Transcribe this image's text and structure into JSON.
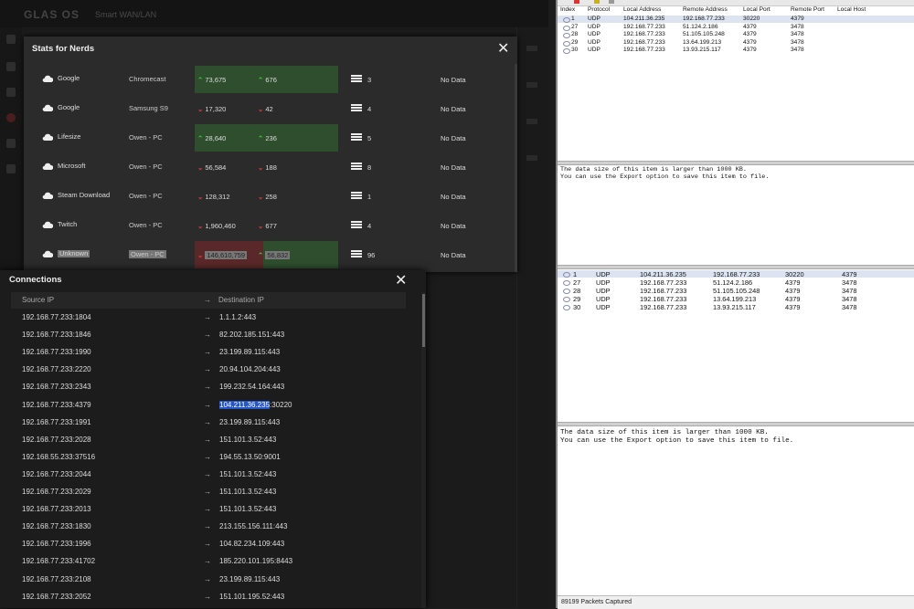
{
  "background_app": {
    "logo": "GLAS OS",
    "device_name": "Smart WAN/LAN"
  },
  "stats_for_nerds": {
    "title": "Stats for Nerds",
    "rows": [
      {
        "app": "Google",
        "device": "Chromecast",
        "down": "73,675",
        "up": "676",
        "count": "3",
        "status": "No Data",
        "tone": "green"
      },
      {
        "app": "Google",
        "device": "Samsung S9",
        "down": "17,320",
        "up": "42",
        "count": "4",
        "status": "No Data",
        "tone": "none"
      },
      {
        "app": "Lifesize",
        "device": "Owen - PC",
        "down": "28,640",
        "up": "236",
        "count": "5",
        "status": "No Data",
        "tone": "green"
      },
      {
        "app": "Microsoft",
        "device": "Owen - PC",
        "down": "56,584",
        "up": "188",
        "count": "8",
        "status": "No Data",
        "tone": "none"
      },
      {
        "app": "Steam Download",
        "device": "Owen - PC",
        "down": "128,312",
        "up": "258",
        "count": "1",
        "status": "No Data",
        "tone": "none"
      },
      {
        "app": "Twitch",
        "device": "Owen - PC",
        "down": "1,960,460",
        "up": "677",
        "count": "4",
        "status": "No Data",
        "tone": "none"
      },
      {
        "app": "Unknown",
        "device": "Owen - PC",
        "down": "146,610,759",
        "up": "56,832",
        "count": "96",
        "status": "No Data",
        "tone": "mixed"
      }
    ]
  },
  "connections": {
    "title": "Connections",
    "col_source": "Source IP",
    "col_dest": "Destination IP",
    "arrow": "→",
    "rows": [
      {
        "src": "192.168.77.233:1804",
        "dst": "1.1.1.2:443"
      },
      {
        "src": "192.168.77.233:1846",
        "dst": "82.202.185.151:443"
      },
      {
        "src": "192.168.77.233:1990",
        "dst": "23.199.89.115:443"
      },
      {
        "src": "192.168.77.233:2220",
        "dst": "20.94.104.204:443"
      },
      {
        "src": "192.168.77.233:2343",
        "dst": "199.232.54.164:443"
      },
      {
        "src": "192.168.77.233:4379",
        "dst_sel": "104.211.36.235",
        "dst_rest": ":30220"
      },
      {
        "src": "192.168.77.233:1991",
        "dst": "23.199.89.115:443"
      },
      {
        "src": "192.168.77.233:2028",
        "dst": "151.101.3.52:443"
      },
      {
        "src": "192.168.55.233:37516",
        "dst": "194.55.13.50:9001"
      },
      {
        "src": "192.168.77.233:2044",
        "dst": "151.101.3.52:443"
      },
      {
        "src": "192.168.77.233:2029",
        "dst": "151.101.3.52:443"
      },
      {
        "src": "192.168.77.233:2013",
        "dst": "151.101.3.52:443"
      },
      {
        "src": "192.168.77.233:1830",
        "dst": "213.155.156.111:443"
      },
      {
        "src": "192.168.77.233:1996",
        "dst": "104.82.234.109:443"
      },
      {
        "src": "192.168.77.233:41702",
        "dst": "185.220.101.195:8443"
      },
      {
        "src": "192.168.77.233:2108",
        "dst": "23.199.89.115:443"
      },
      {
        "src": "192.168.77.233:2052",
        "dst": "151.101.195.52:443"
      }
    ]
  },
  "capture": {
    "headers": {
      "index": "Index",
      "protocol": "Protocol",
      "local": "Local Address",
      "remote": "Remote Address",
      "lport": "Local Port",
      "rport": "Remote Port",
      "host": "Local Host"
    },
    "rows": [
      {
        "index": "1",
        "protocol": "UDP",
        "local": "104.211.36.235",
        "remote": "192.168.77.233",
        "lport": "30220",
        "rport": "4379"
      },
      {
        "index": "27",
        "protocol": "UDP",
        "local": "192.168.77.233",
        "remote": "51.124.2.186",
        "lport": "4379",
        "rport": "3478"
      },
      {
        "index": "28",
        "protocol": "UDP",
        "local": "192.168.77.233",
        "remote": "51.105.105.248",
        "lport": "4379",
        "rport": "3478"
      },
      {
        "index": "29",
        "protocol": "UDP",
        "local": "192.168.77.233",
        "remote": "13.64.199.213",
        "lport": "4379",
        "rport": "3478"
      },
      {
        "index": "30",
        "protocol": "UDP",
        "local": "192.168.77.233",
        "remote": "13.93.215.117",
        "lport": "4379",
        "rport": "3478"
      }
    ],
    "data_msg_line1": "The data size of this item is larger than 1000 KB.",
    "data_msg_line2": "You can use the Export option to save this item to file.",
    "status": "89199 Packets Captured"
  }
}
